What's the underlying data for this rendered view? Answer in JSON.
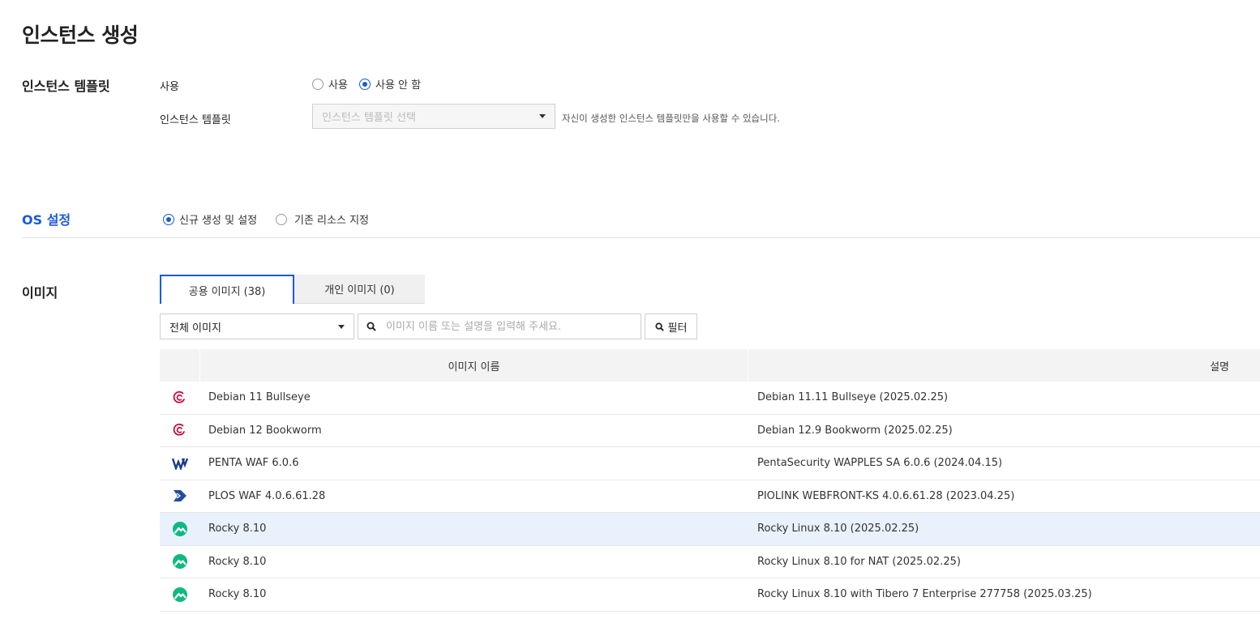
{
  "page": {
    "title": "인스턴스 생성"
  },
  "template_section": {
    "title": "인스턴스 템플릿",
    "use_label": "사용",
    "radio_use": "사용",
    "radio_not_use": "사용 안 함",
    "selected": "사용 안 함",
    "template_label": "인스턴스 템플릿",
    "template_placeholder": "인스턴스 템플릿 선택",
    "hint": "자신이 생성한 인스턴스 템플릿만을 사용할 수 있습니다."
  },
  "os_section": {
    "title": "OS 설정",
    "radio_new": "신규 생성 및 설정",
    "radio_existing": "기존 리소스 지정",
    "selected": "신규 생성 및 설정"
  },
  "image_section": {
    "title": "이미지",
    "tabs": [
      {
        "label": "공용 이미지 (38)",
        "active": true
      },
      {
        "label": "개인 이미지 (0)",
        "active": false
      }
    ],
    "filter_select": "전체 이미지",
    "search_placeholder": "이미지 이름 또는 설명을 입력해 주세요.",
    "filter_button": "필터",
    "table": {
      "columns": [
        "이미지 이름",
        "설명"
      ],
      "rows": [
        {
          "icon": "debian-icon",
          "name": "Debian 11 Bullseye",
          "desc": "Debian 11.11 Bullseye (2025.02.25)",
          "selected": false
        },
        {
          "icon": "debian-icon",
          "name": "Debian 12 Bookworm",
          "desc": "Debian 12.9 Bookworm (2025.02.25)",
          "selected": false
        },
        {
          "icon": "penta-waf-icon",
          "name": "PENTA WAF 6.0.6",
          "desc": "PentaSecurity WAPPLES SA 6.0.6 (2024.04.15)",
          "selected": false
        },
        {
          "icon": "plos-waf-icon",
          "name": "PLOS WAF 4.0.6.61.28",
          "desc": "PIOLINK WEBFRONT-KS 4.0.6.61.28 (2023.04.25)",
          "selected": false
        },
        {
          "icon": "rocky-icon",
          "name": "Rocky 8.10",
          "desc": "Rocky Linux 8.10 (2025.02.25)",
          "selected": true
        },
        {
          "icon": "rocky-icon",
          "name": "Rocky 8.10",
          "desc": "Rocky Linux 8.10 for NAT (2025.02.25)",
          "selected": false
        },
        {
          "icon": "rocky-icon",
          "name": "Rocky 8.10",
          "desc": "Rocky Linux 8.10 with Tibero 7 Enterprise 277758 (2025.03.25)",
          "selected": false
        }
      ]
    }
  },
  "colors": {
    "accent": "#1a5ad8",
    "selected_row": "#e9f1fd",
    "debian": "#c70036",
    "penta": "#1b3a8c",
    "plos": "#1f4e9c",
    "rocky": "#10b981"
  }
}
